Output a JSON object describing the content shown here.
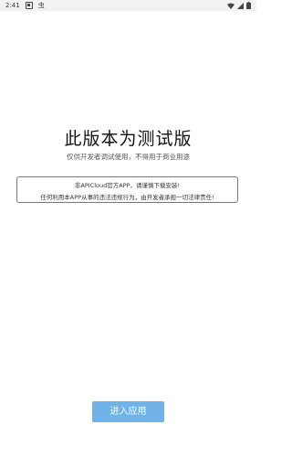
{
  "status_bar": {
    "time": "2:41",
    "app_icon_text": "虫"
  },
  "main": {
    "title": "此版本为测试版",
    "subtitle": "仅供开发者调试使用，不得用于商业用途",
    "notice": {
      "line1": "非APICloud官方APP，请谨慎下载安装!",
      "line2": "任何利用本APP从事的违法违规行为，由开发者承担一切法律责任!"
    },
    "enter_button_label": "进入应用"
  },
  "colors": {
    "button_bg": "#6fb3e8",
    "status_bar_bg": "#f2f2f2"
  }
}
